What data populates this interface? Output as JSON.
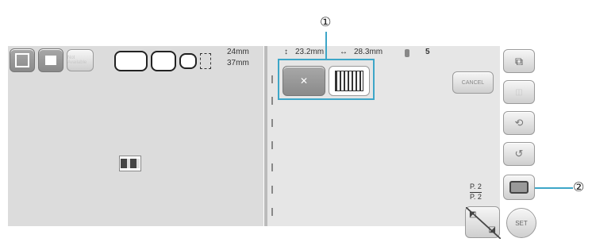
{
  "callouts": {
    "one": "①",
    "two": "②"
  },
  "left_toolbar": {
    "size_height": "24mm",
    "size_width": "37mm",
    "not_available_label": "Not Available"
  },
  "right_header": {
    "height_readout": "23.2mm",
    "width_readout": "28.3mm",
    "color_count": "5"
  },
  "cancel_label": "CANCEL",
  "page_indicator": {
    "current": "P. 2",
    "total": "P. 2"
  },
  "set_label": "SET",
  "colors": {
    "accent": "#3da6c8",
    "panel": "#dcdcdc",
    "frame": "#222222"
  }
}
